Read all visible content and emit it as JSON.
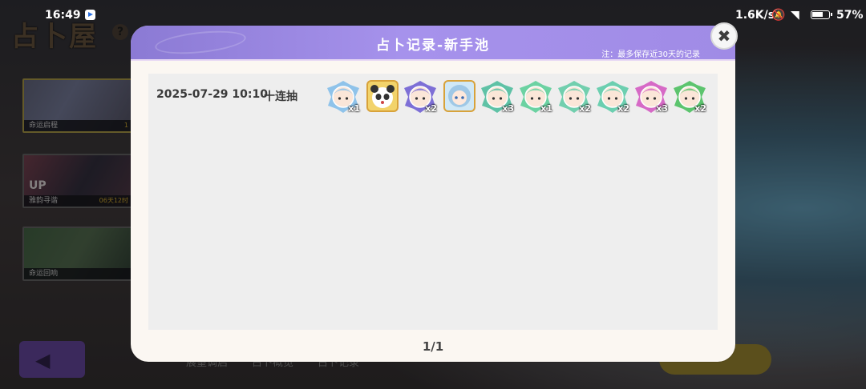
{
  "status_bar": {
    "time": "16:49",
    "net_speed": "1.6K/s",
    "battery": "57%"
  },
  "game": {
    "title": "占卜屋",
    "banners": [
      {
        "label": "命运启程",
        "timer": "1"
      },
      {
        "label": "雅韵寻谐",
        "timer": "06天12时"
      },
      {
        "label": "命运回响",
        "timer": ""
      }
    ],
    "bottom_tabs": [
      "展望调启",
      "占卜概览",
      "占卜记录"
    ]
  },
  "modal": {
    "title": "占卜记录-新手池",
    "note": "注：最多保存近30天的记录",
    "records": [
      {
        "time": "2025-07-29 10:10",
        "type": "十连抽",
        "results": [
          {
            "count": "x1",
            "frame": "shard",
            "color": "#8fc3ea",
            "icon": "brown-hair-girl"
          },
          {
            "count": "",
            "frame": "full",
            "color": "#f2d36b",
            "icon": "panda"
          },
          {
            "count": "x2",
            "frame": "shard",
            "color": "#7d6fd6",
            "icon": "purple-hair-girl"
          },
          {
            "count": "",
            "frame": "full",
            "color": "#d0e8f6",
            "icon": "silver-hair-girl"
          },
          {
            "count": "x3",
            "frame": "shard",
            "color": "#5fc2a6",
            "icon": "fox"
          },
          {
            "count": "x1",
            "frame": "shard",
            "color": "#6cd2a2",
            "icon": "white-hair-girl"
          },
          {
            "count": "x2",
            "frame": "shard",
            "color": "#72cfae",
            "icon": "teal-hair-girl"
          },
          {
            "count": "x2",
            "frame": "shard",
            "color": "#6ccfb0",
            "icon": "mint-hair-girl"
          },
          {
            "count": "x3",
            "frame": "shard",
            "color": "#d66ac6",
            "icon": "pink-hair-girl"
          },
          {
            "count": "x2",
            "frame": "shard",
            "color": "#5cc46e",
            "icon": "green-hair-boy"
          }
        ]
      }
    ],
    "pager": "1/1"
  }
}
